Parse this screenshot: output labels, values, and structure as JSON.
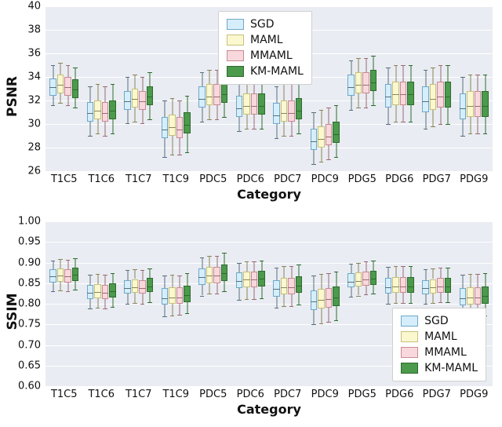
{
  "legend": [
    "SGD",
    "MAML",
    "MMAML",
    "KM-MAML"
  ],
  "xlabel": "Category",
  "categories": [
    "T1C5",
    "T1C6",
    "T1C7",
    "T1C9",
    "PDC5",
    "PDC6",
    "PDC7",
    "PDC9",
    "PDG5",
    "PDG6",
    "PDG7",
    "PDG9"
  ],
  "panels": {
    "psnr": {
      "ylabel": "PSNR",
      "ylim": [
        26,
        40
      ],
      "yticks": [
        26,
        28,
        30,
        32,
        34,
        36,
        38,
        40
      ]
    },
    "ssim": {
      "ylabel": "SSIM",
      "ylim": [
        0.6,
        1.0
      ],
      "yticks": [
        0.6,
        0.65,
        0.7,
        0.75,
        0.8,
        0.85,
        0.9,
        0.95,
        1.0
      ]
    }
  },
  "chart_data": [
    {
      "type": "box",
      "title": "",
      "xlabel": "Category",
      "ylabel": "PSNR",
      "ylim": [
        26,
        40
      ],
      "categories": [
        "T1C5",
        "T1C6",
        "T1C7",
        "T1C9",
        "PDC5",
        "PDC6",
        "PDC7",
        "PDC9",
        "PDG5",
        "PDG6",
        "PDG7",
        "PDG9"
      ],
      "series": [
        {
          "name": "SGD",
          "values": [
            {
              "low": 31.6,
              "q1": 32.4,
              "med": 33.2,
              "q3": 33.9,
              "high": 35.0
            },
            {
              "low": 29.0,
              "q1": 30.2,
              "med": 31.0,
              "q3": 31.9,
              "high": 33.2
            },
            {
              "low": 30.1,
              "q1": 31.2,
              "med": 32.0,
              "q3": 32.8,
              "high": 34.0
            },
            {
              "low": 27.2,
              "q1": 28.8,
              "med": 29.6,
              "q3": 30.6,
              "high": 32.0
            },
            {
              "low": 30.2,
              "q1": 31.4,
              "med": 32.2,
              "q3": 33.2,
              "high": 34.4
            },
            {
              "low": 29.4,
              "q1": 30.6,
              "med": 31.4,
              "q3": 32.4,
              "high": 33.6
            },
            {
              "low": 28.8,
              "q1": 30.0,
              "med": 30.8,
              "q3": 31.8,
              "high": 33.2
            },
            {
              "low": 26.6,
              "q1": 27.8,
              "med": 28.6,
              "q3": 29.6,
              "high": 31.0
            },
            {
              "low": 31.2,
              "q1": 32.4,
              "med": 33.2,
              "q3": 34.2,
              "high": 35.4
            },
            {
              "low": 30.0,
              "q1": 31.4,
              "med": 32.4,
              "q3": 33.4,
              "high": 34.8
            },
            {
              "low": 29.6,
              "q1": 31.0,
              "med": 32.0,
              "q3": 33.2,
              "high": 34.6
            },
            {
              "low": 29.0,
              "q1": 30.4,
              "med": 31.4,
              "q3": 32.6,
              "high": 34.0
            }
          ]
        },
        {
          "name": "MAML",
          "values": [
            {
              "low": 31.8,
              "q1": 32.6,
              "med": 33.4,
              "q3": 34.2,
              "high": 35.2
            },
            {
              "low": 29.2,
              "q1": 30.4,
              "med": 31.2,
              "q3": 32.0,
              "high": 33.4
            },
            {
              "low": 30.2,
              "q1": 31.4,
              "med": 32.2,
              "q3": 33.0,
              "high": 34.2
            },
            {
              "low": 27.4,
              "q1": 29.0,
              "med": 29.8,
              "q3": 30.8,
              "high": 32.2
            },
            {
              "low": 30.4,
              "q1": 31.6,
              "med": 32.4,
              "q3": 33.4,
              "high": 34.6
            },
            {
              "low": 29.6,
              "q1": 30.8,
              "med": 31.6,
              "q3": 32.6,
              "high": 33.8
            },
            {
              "low": 29.0,
              "q1": 30.2,
              "med": 31.0,
              "q3": 32.0,
              "high": 33.4
            },
            {
              "low": 26.8,
              "q1": 28.0,
              "med": 28.8,
              "q3": 29.8,
              "high": 31.2
            },
            {
              "low": 31.4,
              "q1": 32.6,
              "med": 33.4,
              "q3": 34.4,
              "high": 35.6
            },
            {
              "low": 30.2,
              "q1": 31.6,
              "med": 32.6,
              "q3": 33.6,
              "high": 35.0
            },
            {
              "low": 29.8,
              "q1": 31.2,
              "med": 32.2,
              "q3": 33.4,
              "high": 34.8
            },
            {
              "low": 29.2,
              "q1": 30.6,
              "med": 31.6,
              "q3": 32.8,
              "high": 34.2
            }
          ]
        },
        {
          "name": "MMAML",
          "values": [
            {
              "low": 31.6,
              "q1": 32.4,
              "med": 33.2,
              "q3": 34.0,
              "high": 35.0
            },
            {
              "low": 29.0,
              "q1": 30.2,
              "med": 31.0,
              "q3": 31.9,
              "high": 33.2
            },
            {
              "low": 30.1,
              "q1": 31.2,
              "med": 32.0,
              "q3": 32.8,
              "high": 34.0
            },
            {
              "low": 27.4,
              "q1": 28.8,
              "med": 29.6,
              "q3": 30.6,
              "high": 32.0
            },
            {
              "low": 30.4,
              "q1": 31.6,
              "med": 32.4,
              "q3": 33.4,
              "high": 34.6
            },
            {
              "low": 29.6,
              "q1": 30.8,
              "med": 31.6,
              "q3": 32.6,
              "high": 33.8
            },
            {
              "low": 29.0,
              "q1": 30.2,
              "med": 31.0,
              "q3": 32.0,
              "high": 33.4
            },
            {
              "low": 27.0,
              "q1": 28.2,
              "med": 29.0,
              "q3": 30.0,
              "high": 31.4
            },
            {
              "low": 31.4,
              "q1": 32.6,
              "med": 33.4,
              "q3": 34.4,
              "high": 35.6
            },
            {
              "low": 30.2,
              "q1": 31.6,
              "med": 32.6,
              "q3": 33.6,
              "high": 35.0
            },
            {
              "low": 30.0,
              "q1": 31.4,
              "med": 32.4,
              "q3": 33.6,
              "high": 35.0
            },
            {
              "low": 29.2,
              "q1": 30.6,
              "med": 31.6,
              "q3": 32.8,
              "high": 34.2
            }
          ]
        },
        {
          "name": "KM-MAML",
          "values": [
            {
              "low": 31.4,
              "q1": 32.2,
              "med": 33.0,
              "q3": 33.8,
              "high": 34.8
            },
            {
              "low": 29.2,
              "q1": 30.4,
              "med": 31.2,
              "q3": 32.0,
              "high": 33.4
            },
            {
              "low": 30.4,
              "q1": 31.6,
              "med": 32.4,
              "q3": 33.2,
              "high": 34.4
            },
            {
              "low": 27.6,
              "q1": 29.2,
              "med": 30.0,
              "q3": 31.0,
              "high": 32.4
            },
            {
              "low": 30.6,
              "q1": 31.8,
              "med": 32.6,
              "q3": 33.6,
              "high": 34.8
            },
            {
              "low": 29.6,
              "q1": 30.8,
              "med": 31.6,
              "q3": 32.6,
              "high": 33.8
            },
            {
              "low": 29.2,
              "q1": 30.4,
              "med": 31.2,
              "q3": 32.2,
              "high": 33.6
            },
            {
              "low": 27.2,
              "q1": 28.4,
              "med": 29.2,
              "q3": 30.2,
              "high": 31.6
            },
            {
              "low": 31.6,
              "q1": 32.8,
              "med": 33.6,
              "q3": 34.6,
              "high": 35.8
            },
            {
              "low": 30.2,
              "q1": 31.6,
              "med": 32.6,
              "q3": 33.6,
              "high": 35.0
            },
            {
              "low": 30.0,
              "q1": 31.4,
              "med": 32.4,
              "q3": 33.6,
              "high": 35.0
            },
            {
              "low": 29.2,
              "q1": 30.6,
              "med": 31.6,
              "q3": 32.8,
              "high": 34.2
            }
          ]
        }
      ]
    },
    {
      "type": "box",
      "title": "",
      "xlabel": "Category",
      "ylabel": "SSIM",
      "ylim": [
        0.6,
        1.0
      ],
      "categories": [
        "T1C5",
        "T1C6",
        "T1C7",
        "T1C9",
        "PDC5",
        "PDC6",
        "PDC7",
        "PDC9",
        "PDG5",
        "PDG6",
        "PDG7",
        "PDG9"
      ],
      "series": [
        {
          "name": "SGD",
          "values": [
            {
              "low": 0.83,
              "q1": 0.852,
              "med": 0.868,
              "q3": 0.884,
              "high": 0.905
            },
            {
              "low": 0.788,
              "q1": 0.812,
              "med": 0.828,
              "q3": 0.846,
              "high": 0.87
            },
            {
              "low": 0.8,
              "q1": 0.824,
              "med": 0.84,
              "q3": 0.858,
              "high": 0.882
            },
            {
              "low": 0.77,
              "q1": 0.798,
              "med": 0.816,
              "q3": 0.838,
              "high": 0.868
            },
            {
              "low": 0.82,
              "q1": 0.846,
              "med": 0.866,
              "q3": 0.886,
              "high": 0.912
            },
            {
              "low": 0.81,
              "q1": 0.838,
              "med": 0.858,
              "q3": 0.876,
              "high": 0.9
            },
            {
              "low": 0.79,
              "q1": 0.818,
              "med": 0.838,
              "q3": 0.858,
              "high": 0.888
            },
            {
              "low": 0.75,
              "q1": 0.784,
              "med": 0.808,
              "q3": 0.832,
              "high": 0.868
            },
            {
              "low": 0.818,
              "q1": 0.84,
              "med": 0.856,
              "q3": 0.874,
              "high": 0.898
            },
            {
              "low": 0.8,
              "q1": 0.824,
              "med": 0.842,
              "q3": 0.862,
              "high": 0.89
            },
            {
              "low": 0.8,
              "q1": 0.822,
              "med": 0.84,
              "q3": 0.858,
              "high": 0.884
            },
            {
              "low": 0.768,
              "q1": 0.796,
              "med": 0.816,
              "q3": 0.838,
              "high": 0.87
            }
          ]
        },
        {
          "name": "MAML",
          "values": [
            {
              "low": 0.832,
              "q1": 0.854,
              "med": 0.87,
              "q3": 0.886,
              "high": 0.908
            },
            {
              "low": 0.79,
              "q1": 0.814,
              "med": 0.83,
              "q3": 0.848,
              "high": 0.872
            },
            {
              "low": 0.802,
              "q1": 0.826,
              "med": 0.842,
              "q3": 0.86,
              "high": 0.884
            },
            {
              "low": 0.772,
              "q1": 0.8,
              "med": 0.818,
              "q3": 0.84,
              "high": 0.87
            },
            {
              "low": 0.824,
              "q1": 0.85,
              "med": 0.87,
              "q3": 0.89,
              "high": 0.916
            },
            {
              "low": 0.812,
              "q1": 0.84,
              "med": 0.86,
              "q3": 0.878,
              "high": 0.902
            },
            {
              "low": 0.794,
              "q1": 0.822,
              "med": 0.842,
              "q3": 0.862,
              "high": 0.892
            },
            {
              "low": 0.752,
              "q1": 0.788,
              "med": 0.812,
              "q3": 0.836,
              "high": 0.872
            },
            {
              "low": 0.82,
              "q1": 0.842,
              "med": 0.858,
              "q3": 0.876,
              "high": 0.9
            },
            {
              "low": 0.802,
              "q1": 0.826,
              "med": 0.844,
              "q3": 0.864,
              "high": 0.892
            },
            {
              "low": 0.802,
              "q1": 0.824,
              "med": 0.842,
              "q3": 0.86,
              "high": 0.886
            },
            {
              "low": 0.77,
              "q1": 0.798,
              "med": 0.818,
              "q3": 0.84,
              "high": 0.872
            }
          ]
        },
        {
          "name": "MMAML",
          "values": [
            {
              "low": 0.83,
              "q1": 0.852,
              "med": 0.868,
              "q3": 0.884,
              "high": 0.906
            },
            {
              "low": 0.788,
              "q1": 0.812,
              "med": 0.828,
              "q3": 0.846,
              "high": 0.87
            },
            {
              "low": 0.8,
              "q1": 0.824,
              "med": 0.84,
              "q3": 0.858,
              "high": 0.882
            },
            {
              "low": 0.774,
              "q1": 0.8,
              "med": 0.818,
              "q3": 0.84,
              "high": 0.868
            },
            {
              "low": 0.824,
              "q1": 0.85,
              "med": 0.87,
              "q3": 0.89,
              "high": 0.916
            },
            {
              "low": 0.812,
              "q1": 0.84,
              "med": 0.86,
              "q3": 0.878,
              "high": 0.902
            },
            {
              "low": 0.794,
              "q1": 0.822,
              "med": 0.842,
              "q3": 0.862,
              "high": 0.892
            },
            {
              "low": 0.756,
              "q1": 0.79,
              "med": 0.814,
              "q3": 0.838,
              "high": 0.874
            },
            {
              "low": 0.822,
              "q1": 0.844,
              "med": 0.86,
              "q3": 0.878,
              "high": 0.902
            },
            {
              "low": 0.802,
              "q1": 0.826,
              "med": 0.844,
              "q3": 0.864,
              "high": 0.892
            },
            {
              "low": 0.804,
              "q1": 0.826,
              "med": 0.844,
              "q3": 0.862,
              "high": 0.888
            },
            {
              "low": 0.77,
              "q1": 0.798,
              "med": 0.818,
              "q3": 0.84,
              "high": 0.872
            }
          ]
        },
        {
          "name": "KM-MAML",
          "values": [
            {
              "low": 0.834,
              "q1": 0.856,
              "med": 0.872,
              "q3": 0.888,
              "high": 0.91
            },
            {
              "low": 0.792,
              "q1": 0.816,
              "med": 0.832,
              "q3": 0.85,
              "high": 0.874
            },
            {
              "low": 0.804,
              "q1": 0.828,
              "med": 0.844,
              "q3": 0.862,
              "high": 0.886
            },
            {
              "low": 0.778,
              "q1": 0.804,
              "med": 0.822,
              "q3": 0.844,
              "high": 0.874
            },
            {
              "low": 0.83,
              "q1": 0.856,
              "med": 0.876,
              "q3": 0.896,
              "high": 0.924
            },
            {
              "low": 0.814,
              "q1": 0.842,
              "med": 0.862,
              "q3": 0.88,
              "high": 0.904
            },
            {
              "low": 0.798,
              "q1": 0.826,
              "med": 0.846,
              "q3": 0.866,
              "high": 0.896
            },
            {
              "low": 0.76,
              "q1": 0.794,
              "med": 0.818,
              "q3": 0.842,
              "high": 0.878
            },
            {
              "low": 0.824,
              "q1": 0.846,
              "med": 0.862,
              "q3": 0.88,
              "high": 0.904
            },
            {
              "low": 0.802,
              "q1": 0.826,
              "med": 0.844,
              "q3": 0.864,
              "high": 0.892
            },
            {
              "low": 0.804,
              "q1": 0.826,
              "med": 0.844,
              "q3": 0.862,
              "high": 0.888
            },
            {
              "low": 0.772,
              "q1": 0.8,
              "med": 0.82,
              "q3": 0.842,
              "high": 0.874
            }
          ]
        }
      ]
    }
  ]
}
